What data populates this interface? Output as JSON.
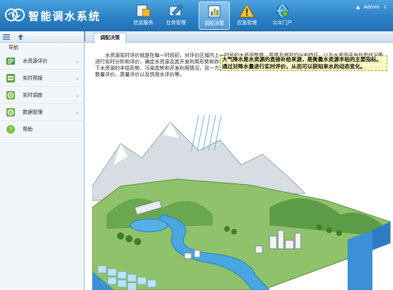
{
  "header": {
    "title": "智能调水系统",
    "nav": [
      {
        "label": "信息服务",
        "icon": "info-service-icon",
        "active": false
      },
      {
        "label": "业务管理",
        "icon": "business-management-icon",
        "active": false
      },
      {
        "label": "调配决策",
        "icon": "dispatch-decision-icon",
        "active": true
      },
      {
        "label": "应急管理",
        "icon": "emergency-warning-icon",
        "active": false
      },
      {
        "label": "公众门户",
        "icon": "public-portal-icon",
        "active": false
      }
    ],
    "user_name": "Admin"
  },
  "sidebar": {
    "heading": "导航",
    "items": [
      {
        "label": "水资源评价",
        "icon": "water-evaluation-icon",
        "expandable": true
      },
      {
        "label": "实时预报",
        "icon": "realtime-forecast-icon",
        "expandable": true
      },
      {
        "label": "实时调度",
        "icon": "realtime-dispatch-icon",
        "expandable": true
      },
      {
        "label": "数据管理",
        "icon": "data-management-icon",
        "expandable": true
      },
      {
        "label": "帮助",
        "icon": "help-icon",
        "expandable": false
      }
    ]
  },
  "main": {
    "tab_label": "调配决策",
    "paragraph": "水资源实时评价就是在每一时段初，对评价区域内上一时段的水资源数量、质量及其时空分布特征，以及水资源开发利用状况等进行实时分析和评价，确定水资源及其开发利用形势和存在的问题。水资源实时评价的目的，一方面在于了解区域内现状下垫面条件下水资源的丰枯形势、污染态势和开发利用情况，另一方面为水的动态管理，量化管理和科学管理提供参考依据。主要包括水资源的数量评价、质量评价以及供用水评价等。",
    "figure_caption": "大气降水是水资源的直接补给来源，是衡量水资源丰枯的主要指标。通过对降水量进行实时评价，从而可以获知来水的动态变化。"
  },
  "colors": {
    "header_top": "#4aa2de",
    "header_bottom": "#2273b6",
    "sidebar_bg": "#f2f6fa",
    "accent": "#2d7ec3"
  }
}
